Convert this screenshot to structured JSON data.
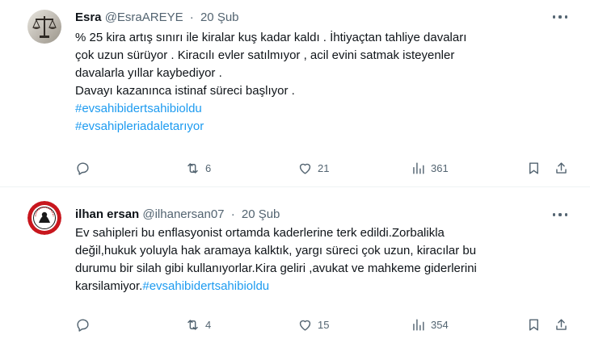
{
  "tweets": [
    {
      "name": "Esra",
      "handle": "@EsraAREYE",
      "separator": "·",
      "date": "20 Şub",
      "lines": [
        "% 25 kira artış sınırı ile kiralar kuş kadar kaldı . İhtiyaçtan tahliye davaları",
        "çok uzun sürüyor . Kiracılı evler satılmıyor , acil evini satmak isteyenler",
        "davalarla yıllar kaybediyor .",
        "Davayı kazanınca istinaf süreci başlıyor ."
      ],
      "hashtags": [
        "#evsahibidertsahibioldu",
        "#evsahipleriadaletarıyor"
      ],
      "replies": "",
      "retweets": "6",
      "likes": "21",
      "views": "361",
      "avatar_icon": "scales-of-justice-icon"
    },
    {
      "name": "ilhan ersan",
      "handle": "@ilhanersan07",
      "separator": "·",
      "date": "20 Şub",
      "lines": [
        "Ev sahipleri bu enflasyonist ortamda kaderlerine terk edildi.Zorbalikla",
        "değil,hukuk yoluyla hak aramaya kalktık, yargı süreci çok uzun, kiracılar bu",
        "durumu bir silah gibi kullanıyorlar.Kira geliri ,avukat ve mahkeme giderlerini"
      ],
      "last_line_text": "karsilamiyor.",
      "last_line_hashtag": "#evsahibidertsahibioldu",
      "replies": "",
      "retweets": "4",
      "likes": "15",
      "views": "354",
      "avatar_icon": "club-badge-icon"
    }
  ],
  "colors": {
    "text": "#0f1419",
    "muted": "#536471",
    "link": "#1d9bf0",
    "divider": "#eff3f4"
  }
}
